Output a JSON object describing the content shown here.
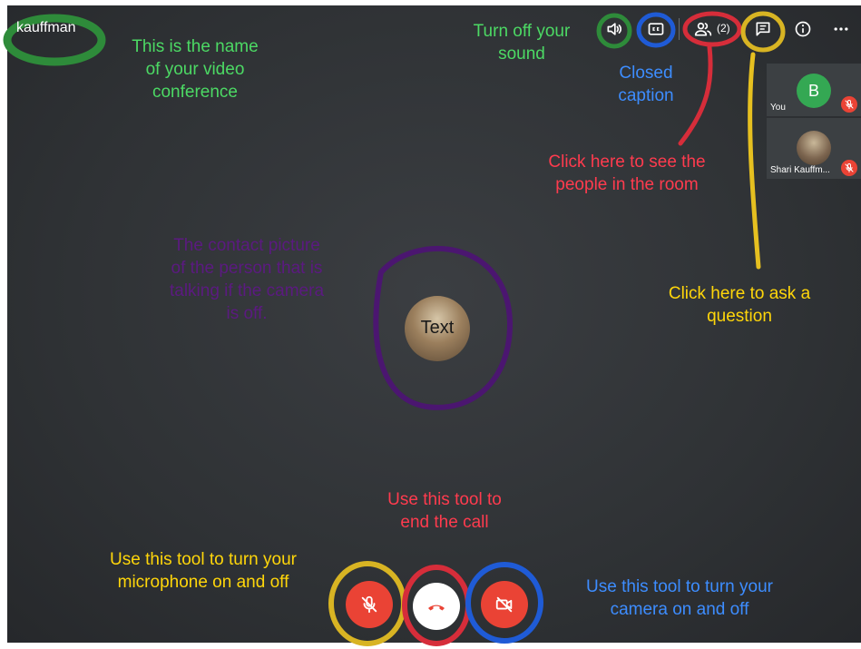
{
  "meeting": {
    "name": "kauffman"
  },
  "toolbar": {
    "people_count": "(2)"
  },
  "participants": [
    {
      "initial": "B",
      "name": "You",
      "avatar_color": "#34a853"
    },
    {
      "name": "Shari Kauffm..."
    }
  ],
  "speaker": {
    "avatar_text": "Text"
  },
  "annotations": {
    "meeting_name": [
      "This is the name",
      "of your video",
      "conference"
    ],
    "sound": [
      "Turn off your",
      "sound"
    ],
    "captions": [
      "Closed",
      "caption"
    ],
    "people": [
      "Click here to see the",
      "people in the room"
    ],
    "chat": [
      "Click here to ask a",
      "question"
    ],
    "speaker": [
      "The contact picture",
      "of the person that is",
      "talking if the camera",
      "is off."
    ],
    "end_call": [
      "Use this tool to",
      "end the call"
    ],
    "microphone": [
      "Use this tool to turn your",
      "microphone on and off"
    ],
    "camera": [
      "Use this tool to turn your",
      "camera on and off"
    ]
  },
  "colors": {
    "annotation_green": "#4cd964",
    "annotation_blue": "#3d8dff",
    "annotation_red": "#ff3b4e",
    "annotation_yellow": "#ffd60a",
    "annotation_purple": "#5b1a80",
    "control_red": "#ea4335"
  },
  "icons": [
    "volume-icon",
    "closed-caption-icon",
    "people-icon",
    "chat-icon",
    "info-icon",
    "more-icon",
    "mic-off-icon",
    "hang-up-icon",
    "camera-off-icon"
  ]
}
